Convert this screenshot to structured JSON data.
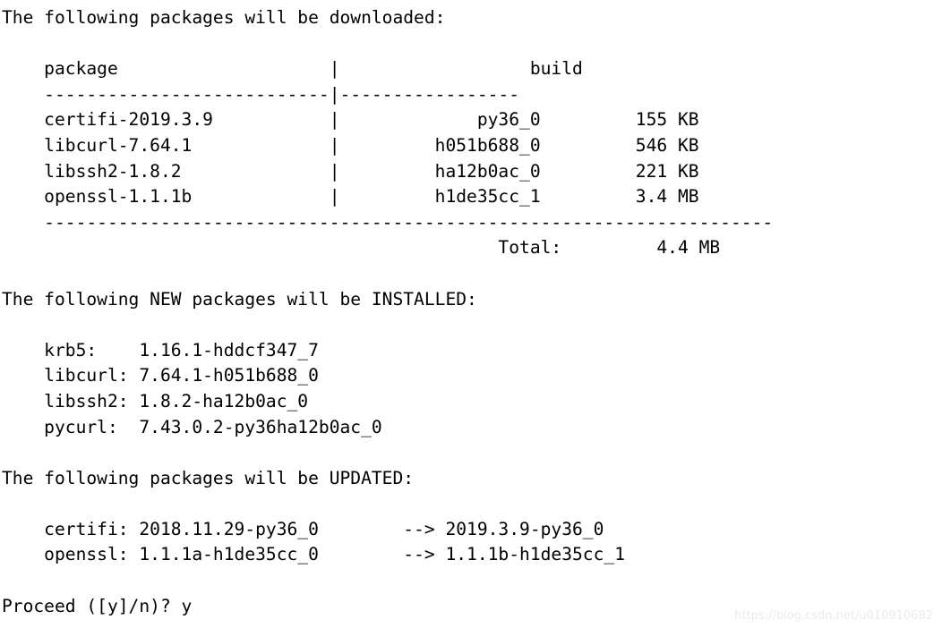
{
  "terminal": {
    "background_color": "#ffffff",
    "text_color": "#000000",
    "watermark": "https://blog.csdn.net/u010910682"
  },
  "download_section": {
    "heading": "The following packages will be downloaded:",
    "column_headers": {
      "package": "package",
      "build": "build"
    },
    "header_separator": "    ---------------------------|-----------------",
    "table_rows": [
      {
        "package": "certifi-2019.3.9",
        "build": "py36_0",
        "size": "155 KB"
      },
      {
        "package": "libcurl-7.64.1",
        "build": "h051b688_0",
        "size": "546 KB"
      },
      {
        "package": "libssh2-1.8.2",
        "build": "ha12b0ac_0",
        "size": "221 KB"
      },
      {
        "package": "openssl-1.1.1b",
        "build": "h1de35cc_1",
        "size": "3.4 MB"
      }
    ],
    "total_separator": "    ---------------------------------------------------------------------",
    "total_label": "Total:",
    "total_size": "4.4 MB",
    "header_line": "    package                    |                  build",
    "row_lines": [
      "    certifi-2019.3.9           |             py36_0         155 KB",
      "    libcurl-7.64.1             |         h051b688_0         546 KB",
      "    libssh2-1.8.2              |         ha12b0ac_0         221 KB",
      "    openssl-1.1.1b             |         h1de35cc_1         3.4 MB"
    ],
    "total_line": "                                               Total:         4.4 MB"
  },
  "installed_section": {
    "heading": "The following NEW packages will be INSTALLED:",
    "packages": [
      {
        "name": "krb5:",
        "version": "1.16.1-hddcf347_7"
      },
      {
        "name": "libcurl:",
        "version": "7.64.1-h051b688_0"
      },
      {
        "name": "libssh2:",
        "version": "1.8.2-ha12b0ac_0"
      },
      {
        "name": "pycurl:",
        "version": "7.43.0.2-py36ha12b0ac_0"
      }
    ],
    "lines": [
      "    krb5:    1.16.1-hddcf347_7",
      "    libcurl: 7.64.1-h051b688_0",
      "    libssh2: 1.8.2-ha12b0ac_0",
      "    pycurl:  7.43.0.2-py36ha12b0ac_0"
    ]
  },
  "updated_section": {
    "heading": "The following packages will be UPDATED:",
    "arrow": "-->",
    "packages": [
      {
        "name": "certifi:",
        "from_version": "2018.11.29-py36_0",
        "to_version": "2019.3.9-py36_0"
      },
      {
        "name": "openssl:",
        "from_version": "1.1.1a-h1de35cc_0",
        "to_version": "1.1.1b-h1de35cc_1"
      }
    ],
    "lines": [
      "    certifi: 2018.11.29-py36_0        --> 2019.3.9-py36_0",
      "    openssl: 1.1.1a-h1de35cc_0        --> 1.1.1b-h1de35cc_1"
    ]
  },
  "prompt": {
    "question": "Proceed ([y]/n)?",
    "answer": "y",
    "line": "Proceed ([y]/n)? y"
  }
}
